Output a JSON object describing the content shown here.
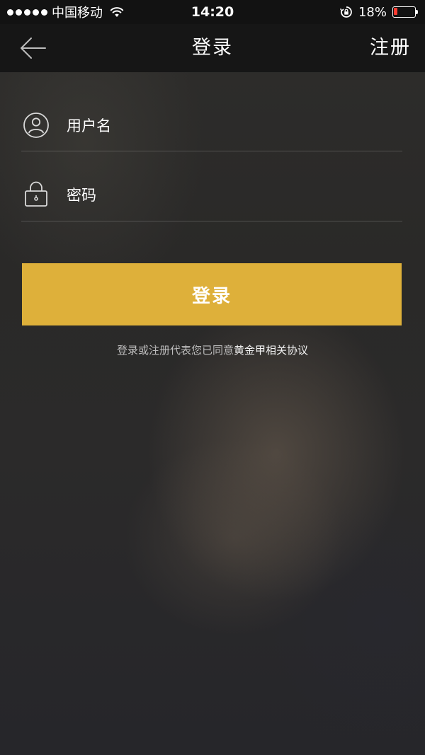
{
  "status_bar": {
    "carrier": "中国移动",
    "time": "14:20",
    "battery_percent": "18%",
    "battery_level": 0.18,
    "battery_color": "#ff3b30",
    "icons": [
      "signal-dots-icon",
      "wifi-icon",
      "rotation-lock-icon",
      "battery-icon"
    ]
  },
  "nav": {
    "back_icon": "arrow-left-icon",
    "title": "登录",
    "register_label": "注册"
  },
  "form": {
    "username": {
      "icon": "user-icon",
      "placeholder": "用户名",
      "value": ""
    },
    "password": {
      "icon": "lock-icon",
      "placeholder": "密码",
      "value": ""
    },
    "login_label": "登录"
  },
  "agreement": {
    "prefix": "登录或注册代表您已同意",
    "link": "黄金甲相关协议"
  },
  "colors": {
    "accent": "#deb03a",
    "nav_background": "#161616",
    "status_background": "#121212"
  }
}
